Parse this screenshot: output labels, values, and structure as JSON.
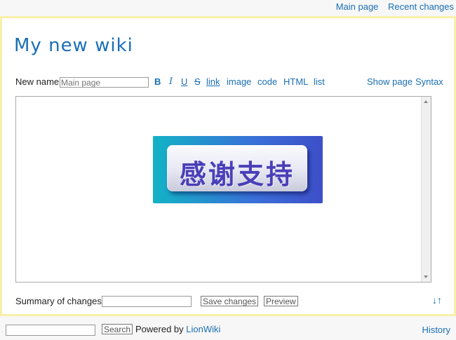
{
  "topnav": {
    "main_page": "Main page",
    "recent_changes": "Recent changes"
  },
  "site_title": "My new wiki",
  "editor_toolbar": {
    "new_name_label": "New name",
    "new_name_placeholder": "Main page",
    "bold": "B",
    "italic": "I",
    "underline": "U",
    "strike": "S",
    "link": "link",
    "image": "image",
    "code": "code",
    "html": "HTML",
    "list": "list",
    "show_page": "Show page",
    "syntax": "Syntax"
  },
  "editor_content": {
    "banner_text": "感谢支持"
  },
  "bottom": {
    "summary_label": "Summary of changes",
    "save_button": "Save changes",
    "preview_button": "Preview",
    "arrows": "↓↑"
  },
  "footer": {
    "search_button": "Search",
    "powered_by": "Powered by",
    "lionwiki": "LionWiki",
    "history": "History"
  },
  "colors": {
    "link": "#1a6fb5",
    "frame_border": "#f8f0a8",
    "background": "#f7f7f7"
  }
}
